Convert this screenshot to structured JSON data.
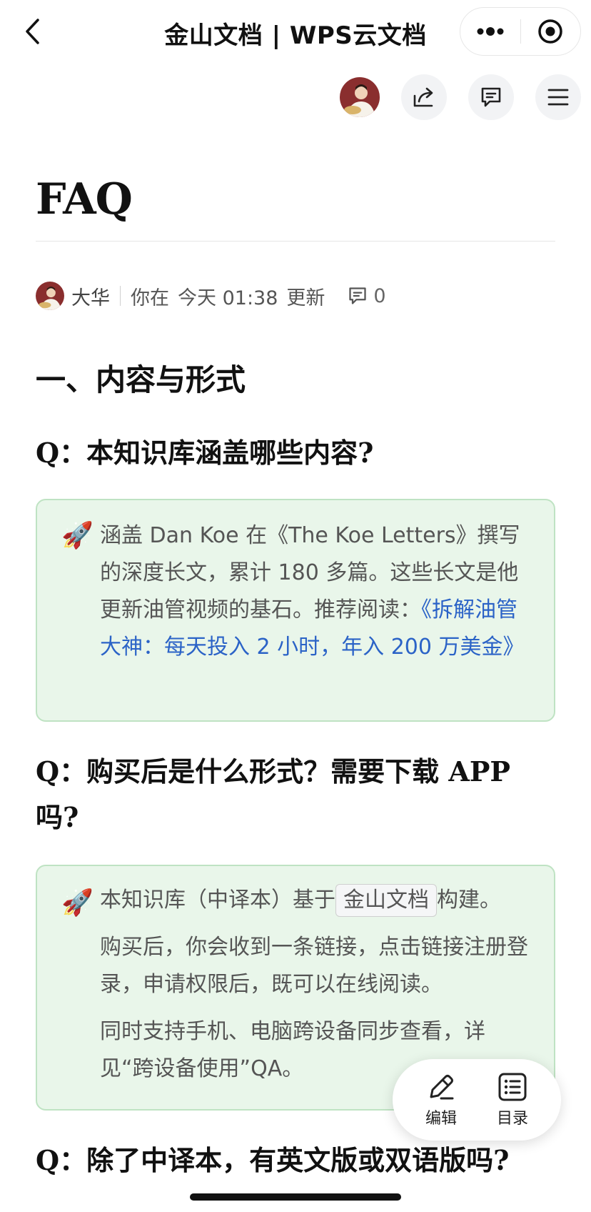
{
  "titlebar": {
    "title": "金山文档 | WPS云文档",
    "back_icon": "chevron-left-icon",
    "more_icon": "more-dots-icon",
    "close_icon": "target-icon"
  },
  "toolbar": {
    "share_icon": "share-icon",
    "comment_icon": "comment-icon",
    "menu_icon": "menu-icon"
  },
  "document": {
    "title": "FAQ",
    "meta": {
      "author": "大华",
      "prefix": "你在",
      "time": "今天 01:38",
      "action": "更新",
      "comment_count": "0"
    },
    "section_heading": "一、内容与形式",
    "questions": [
      {
        "q": "Q：本知识库涵盖哪些内容?"
      },
      {
        "q": "Q：购买后是什么形式？需要下载 APP 吗?"
      },
      {
        "q": "Q：除了中译本，有英文版或双语版吗?"
      }
    ],
    "callout1": {
      "emoji": "🚀",
      "text": "涵盖 Dan Koe 在《The Koe Letters》撰写的深度长文，累计 180 多篇。这些长文是他更新油管视频的基石。推荐阅读：",
      "link": "《拆解油管大神：每天投入 2 小时，年入 200 万美金》"
    },
    "callout2": {
      "emoji": "🚀",
      "p1_before": "本知识库（中译本）基于",
      "p1_chip": "金山文档",
      "p1_after": "构建。",
      "p2": "购买后，你会收到一条链接，点击链接注册登录，申请权限后，既可以在线阅读。",
      "p3": "同时支持手机、电脑跨设备同步查看，详见“跨设备使用”QA。"
    }
  },
  "fab": {
    "edit_label": "编辑",
    "toc_label": "目录"
  },
  "colors": {
    "callout_bg": "#e9f6ea",
    "callout_border": "#bfe3c3",
    "link": "#2b63c7"
  }
}
